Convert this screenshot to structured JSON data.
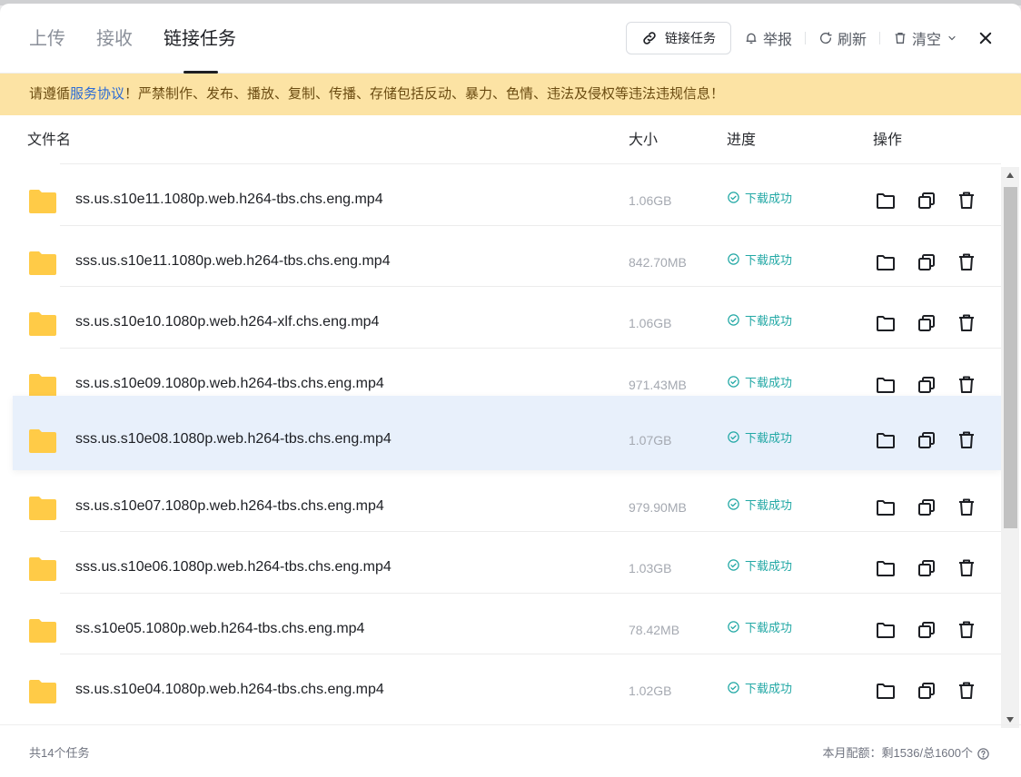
{
  "tabs": [
    {
      "label": "上传",
      "active": false
    },
    {
      "label": "接收",
      "active": false
    },
    {
      "label": "链接任务",
      "active": true
    }
  ],
  "actions": {
    "link_task_label": "链接任务",
    "report_label": "举报",
    "refresh_label": "刷新",
    "clear_label": "清空"
  },
  "notice": {
    "prefix": "请遵循",
    "link": "服务协议",
    "suffix": "！严禁制作、发布、播放、复制、传播、存储包括反动、暴力、色情、违法及侵权等违法违规信息！"
  },
  "columns": {
    "name": "文件名",
    "size": "大小",
    "progress": "进度",
    "ops": "操作"
  },
  "rows": [
    {
      "name": "ss.us.s10e11.1080p.web.h264-tbs.chs.eng.mp4",
      "size": "1.06GB",
      "status": "下载成功"
    },
    {
      "name": "sss.us.s10e11.1080p.web.h264-tbs.chs.eng.mp4",
      "size": "842.70MB",
      "status": "下载成功"
    },
    {
      "name": "ss.us.s10e10.1080p.web.h264-xlf.chs.eng.mp4",
      "size": "1.06GB",
      "status": "下载成功"
    },
    {
      "name": "ss.us.s10e09.1080p.web.h264-tbs.chs.eng.mp4",
      "size": "971.43MB",
      "status": "下载成功"
    },
    {
      "name": "sss.us.s10e08.1080p.web.h264-tbs.chs.eng.mp4",
      "size": "1.07GB",
      "status": "下载成功"
    },
    {
      "name": "ss.us.s10e07.1080p.web.h264-tbs.chs.eng.mp4",
      "size": "979.90MB",
      "status": "下载成功"
    },
    {
      "name": "sss.us.s10e06.1080p.web.h264-tbs.chs.eng.mp4",
      "size": "1.03GB",
      "status": "下载成功"
    },
    {
      "name": "ss.s10e05.1080p.web.h264-tbs.chs.eng.mp4",
      "size": "78.42MB",
      "status": "下载成功"
    },
    {
      "name": "ss.us.s10e04.1080p.web.h264-tbs.chs.eng.mp4",
      "size": "1.02GB",
      "status": "下载成功"
    }
  ],
  "footer": {
    "task_count": "共14个任务",
    "quota": "本月配额：剩1536/总1600个"
  },
  "colors": {
    "accent": "#22a8a5",
    "folder": "#ffcb47",
    "notice_bg": "#fce3a4",
    "link": "#2b6bd6",
    "highlight_row": "#e8f0fb"
  },
  "icons": {
    "link_task": "link-icon",
    "report": "bell-icon",
    "refresh": "refresh-icon",
    "clear": "trash-icon",
    "close": "close-icon",
    "row_folder": "folder-icon",
    "row_status": "check-circle-icon",
    "row_ops": [
      "open-folder-icon",
      "copy-icon",
      "delete-icon"
    ],
    "quota_help": "help-circle-icon"
  }
}
